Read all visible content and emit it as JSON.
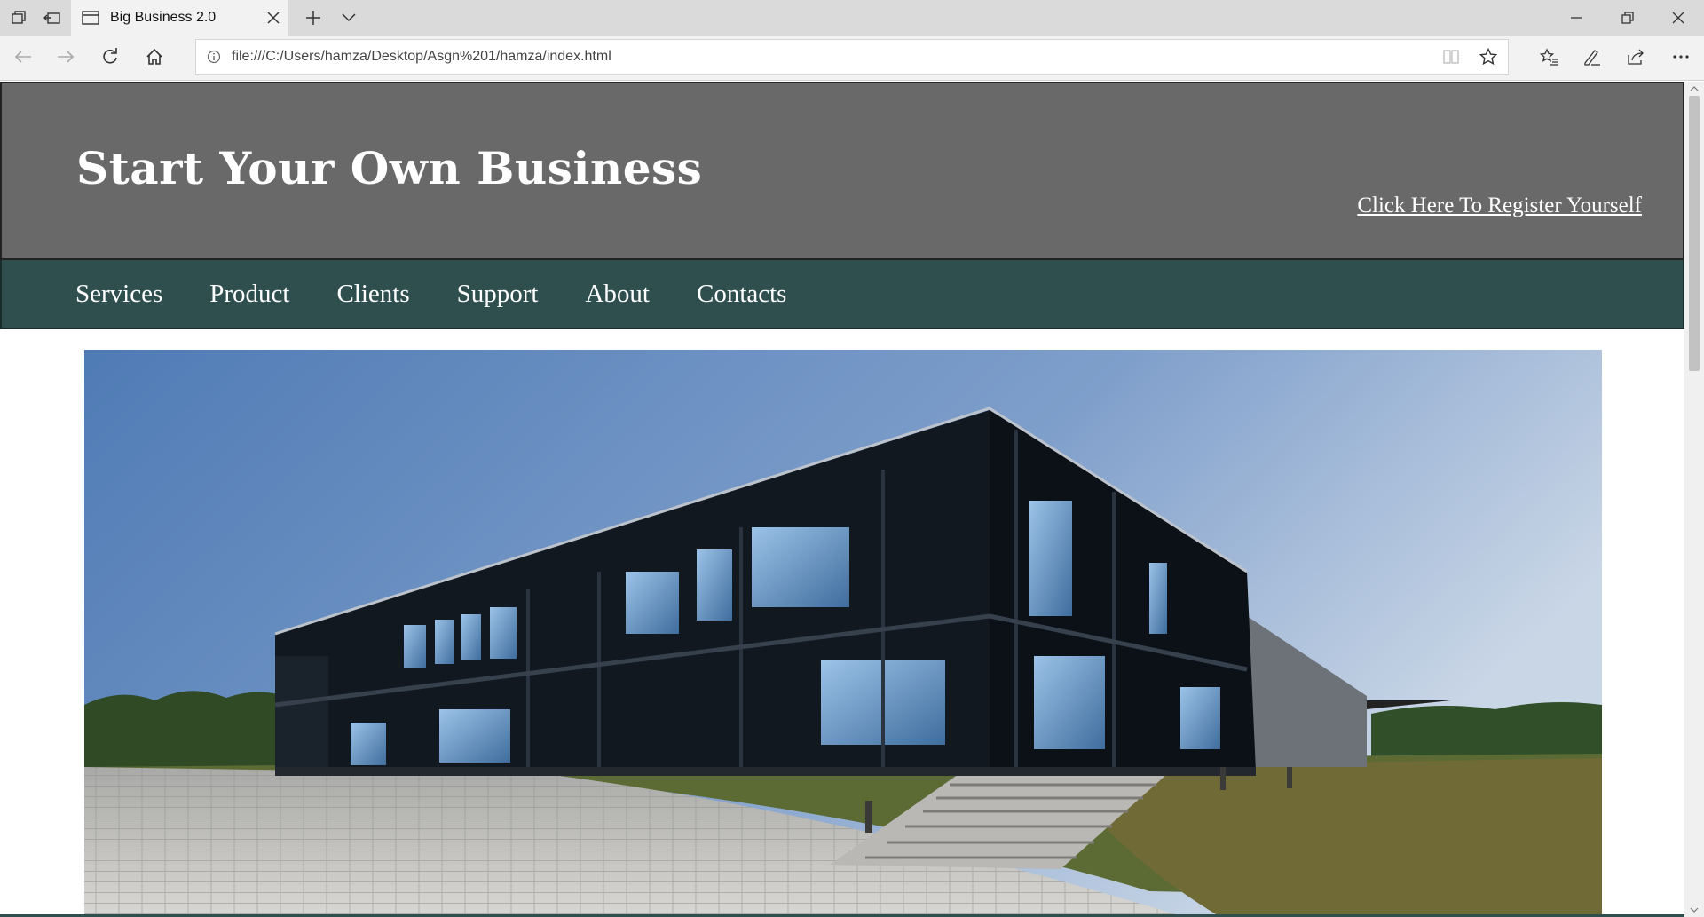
{
  "browser": {
    "tab_title": "Big Business 2.0",
    "url": "file:///C:/Users/hamza/Desktop/Asgn%201/hamza/index.html"
  },
  "header": {
    "title": "Start Your Own Business",
    "register_link": "Click Here To Register Yourself"
  },
  "nav": {
    "items": [
      "Services",
      "Product",
      "Clients",
      "Support",
      "About",
      "Contacts"
    ]
  },
  "colors": {
    "header_bg": "#696969",
    "nav_bg": "#2f4f4f"
  }
}
